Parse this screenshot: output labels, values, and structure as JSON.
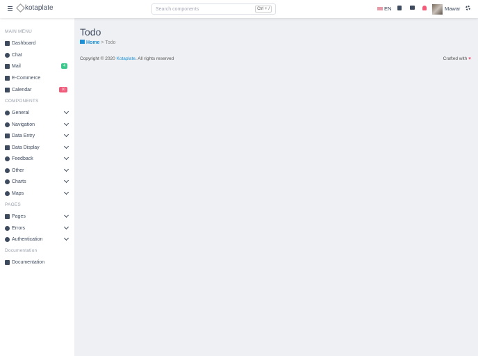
{
  "header": {
    "brand": "kotaplate",
    "search_placeholder": "Search components",
    "search_shortcut": "Ctrl + /",
    "language": "EN",
    "user_name": "Mawar"
  },
  "sidebar": {
    "sections": [
      "MAIN MENU",
      "COMPONENTS",
      "PAGES",
      "Documentation"
    ],
    "main": [
      {
        "label": "Dashboard"
      },
      {
        "label": "Chat"
      },
      {
        "label": "Mail",
        "badge": "4",
        "badge_color": "#3cc88c"
      },
      {
        "label": "E-Commerce"
      },
      {
        "label": "Calendar",
        "badge": "10",
        "badge_color": "#f25a7a"
      }
    ],
    "components": [
      {
        "label": "General"
      },
      {
        "label": "Navigation"
      },
      {
        "label": "Data Entry"
      },
      {
        "label": "Data Display"
      },
      {
        "label": "Feedback"
      },
      {
        "label": "Other"
      },
      {
        "label": "Charts"
      },
      {
        "label": "Maps"
      }
    ],
    "pages": [
      {
        "label": "Pages"
      },
      {
        "label": "Errors"
      },
      {
        "label": "Authentication"
      }
    ],
    "docs": [
      {
        "label": "Documentation"
      }
    ]
  },
  "page": {
    "title": "Todo",
    "breadcrumb_home": "Home",
    "breadcrumb_sep": ">",
    "breadcrumb_current": "Todo"
  },
  "footer": {
    "copyright_prefix": "Copyright © 2020",
    "brand_link": "Kotaplate",
    "copyright_suffix": ". All rights reserved",
    "crafted": "Crafted with"
  }
}
